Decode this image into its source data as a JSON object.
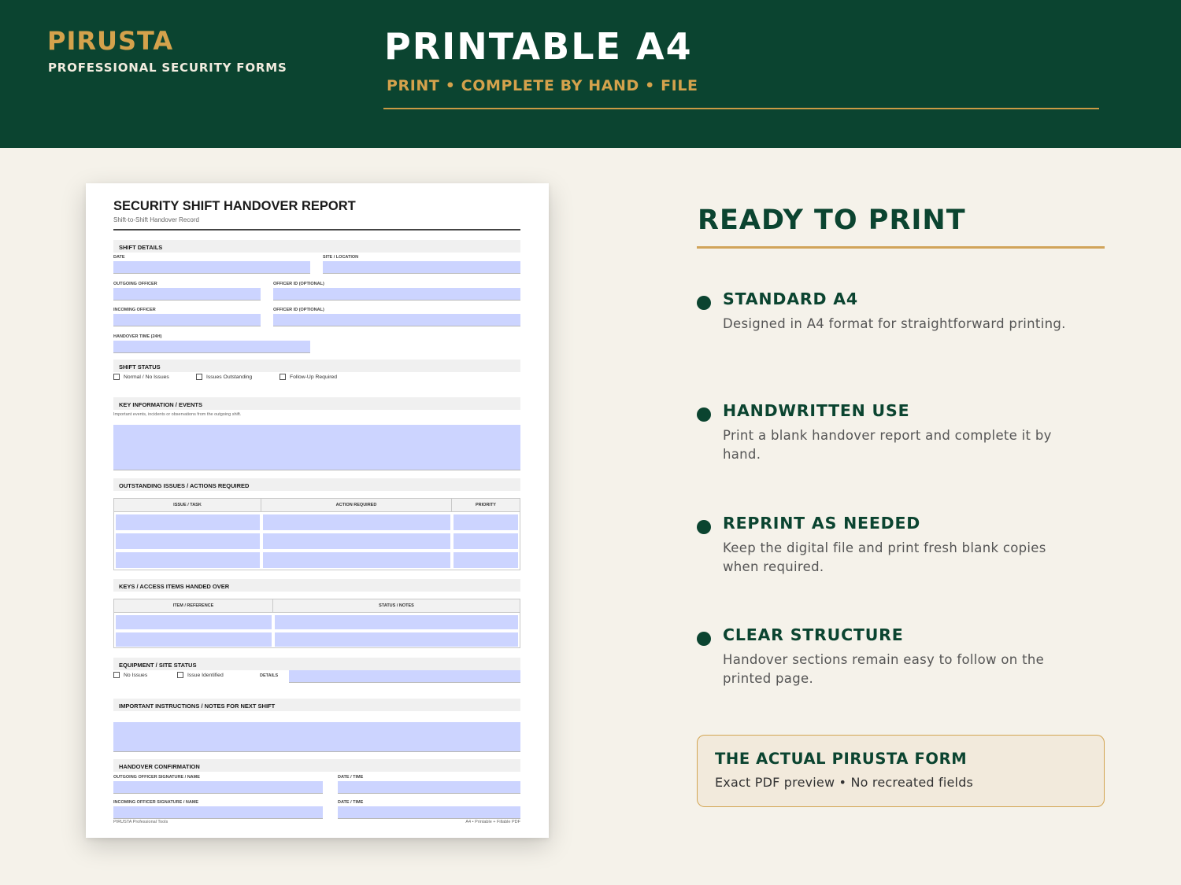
{
  "header": {
    "brand": "PIRUSTA",
    "brand_sub": "PROFESSIONAL SECURITY FORMS",
    "title": "PRINTABLE A4",
    "subtitle": "PRINT • COMPLETE BY HAND • FILE"
  },
  "form": {
    "title": "SECURITY SHIFT HANDOVER REPORT",
    "subtitle": "Shift-to-Shift Handover Record",
    "sections": {
      "shift_details": "SHIFT DETAILS",
      "shift_status": "SHIFT STATUS",
      "key_info": "KEY INFORMATION / EVENTS",
      "outstanding": "OUTSTANDING ISSUES / ACTIONS REQUIRED",
      "keys": "KEYS / ACCESS ITEMS HANDED OVER",
      "equipment": "EQUIPMENT / SITE STATUS",
      "instructions": "IMPORTANT INSTRUCTIONS / NOTES FOR NEXT SHIFT",
      "confirmation": "HANDOVER CONFIRMATION"
    },
    "labels": {
      "date": "DATE",
      "site": "SITE / LOCATION",
      "outgoing_officer": "OUTGOING OFFICER",
      "officer_id_1": "OFFICER ID (OPTIONAL)",
      "incoming_officer": "INCOMING OFFICER",
      "officer_id_2": "OFFICER ID (OPTIONAL)",
      "handover_time": "HANDOVER TIME (24H)",
      "key_info_note": "Important events, incidents or observations from the outgoing shift.",
      "details": "DETAILS",
      "outgoing_sig": "OUTGOING OFFICER SIGNATURE / NAME",
      "date_time_1": "DATE / TIME",
      "incoming_sig": "INCOMING OFFICER SIGNATURE / NAME",
      "date_time_2": "DATE / TIME"
    },
    "status_options": [
      "Normal / No Issues",
      "Issues Outstanding",
      "Follow-Up Required"
    ],
    "equipment_options": [
      "No Issues",
      "Issue Identified"
    ],
    "outstanding_columns": [
      "ISSUE / TASK",
      "ACTION REQUIRED",
      "PRIORITY"
    ],
    "keys_columns": [
      "ITEM / REFERENCE",
      "STATUS / NOTES"
    ],
    "footer_left": "PIRUSTA Professional Tools",
    "footer_right": "A4 • Printable + Fillable PDF"
  },
  "panel": {
    "title": "READY TO PRINT",
    "features": [
      {
        "title": "STANDARD A4",
        "desc": "Designed in A4 format for straightforward printing."
      },
      {
        "title": "HANDWRITTEN USE",
        "desc": "Print a blank handover report and complete it by hand."
      },
      {
        "title": "REPRINT AS NEEDED",
        "desc": "Keep the digital file and print fresh blank copies when required."
      },
      {
        "title": "CLEAR STRUCTURE",
        "desc": "Handover sections remain easy to follow on the printed page."
      }
    ],
    "callout_title": "THE ACTUAL PIRUSTA FORM",
    "callout_text": "Exact PDF preview • No recreated fields"
  },
  "colors": {
    "header_bg": "#0b4430",
    "gold": "#d4a24c",
    "page_bg": "#f5f2ea",
    "field_fill": "#ccd4ff"
  }
}
